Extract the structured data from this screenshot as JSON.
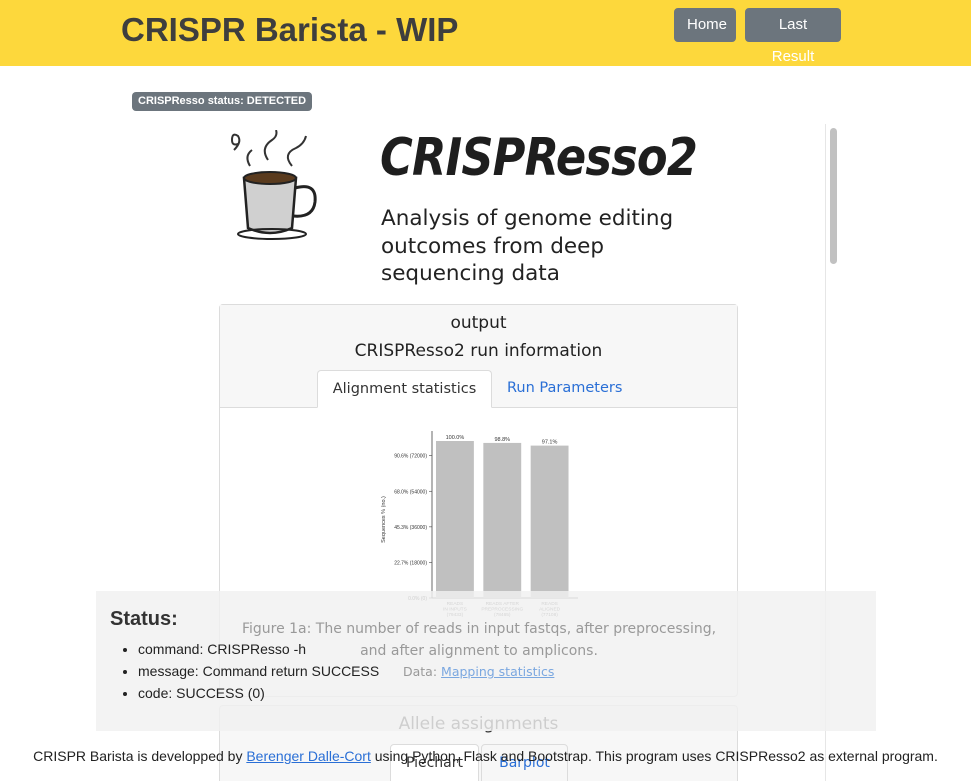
{
  "navbar": {
    "brand": "CRISPR Barista - WIP",
    "home_label": "Home",
    "last_result_label": "Last Result"
  },
  "status_badge": "CRISPResso status: DETECTED",
  "report": {
    "title": "CRISPResso2",
    "subtitle": "Analysis of genome editing outcomes from deep sequencing data",
    "card": {
      "heading": "output",
      "subheading": "CRISPResso2 run information",
      "tabs": [
        "Alignment statistics",
        "Run Parameters"
      ]
    },
    "figure_caption": "Figure 1a: The number of reads in input fastqs, after preprocessing, and after alignment to amplicons.",
    "data_label": "Data:",
    "data_link": "Mapping statistics",
    "allele_card": {
      "title": "Allele assignments",
      "tabs": [
        "Piechart",
        "Barplot"
      ]
    }
  },
  "chart_data": {
    "type": "bar",
    "categories": [
      "READS IN INPUTS (79433)",
      "READS AFTER PREPROCESSING (78465)",
      "READS ALIGNED (77108)"
    ],
    "category_lines": [
      [
        "READS",
        "IN INPUTS",
        "(79433)"
      ],
      [
        "READS AFTER",
        "PREPROCESSING",
        "(78465)"
      ],
      [
        "READS",
        "ALIGNED",
        "(77108)"
      ]
    ],
    "values": [
      79433,
      78465,
      77108
    ],
    "value_labels": [
      "100.0%",
      "98.8%",
      "97.1%"
    ],
    "ylabel": "Sequences % (no.)",
    "ylim": [
      0,
      79433
    ],
    "ytick_values": [
      0,
      18000,
      36000,
      54000,
      72000
    ],
    "ytick_labels": [
      "0.0% (0)",
      "22.7% (18000)",
      "45.3% (36000)",
      "68.0% (54000)",
      "90.6% (72000)"
    ],
    "bar_color": "#c0c0c0"
  },
  "status": {
    "title": "Status:",
    "items": [
      "command: CRISPResso -h",
      "message: Command return SUCCESS",
      "code: SUCCESS (0)"
    ]
  },
  "footer": {
    "prefix": "CRISPR Barista is developped by",
    "author_link": "Berenger Dalle-Cort",
    "suffix": "using Python, Flask and Bootstrap. This program uses CRISPResso2 as external program."
  },
  "colors": {
    "navbar_bg": "#fdd83c",
    "button_gray": "#6c757d",
    "link_blue": "#2a6fd6"
  }
}
